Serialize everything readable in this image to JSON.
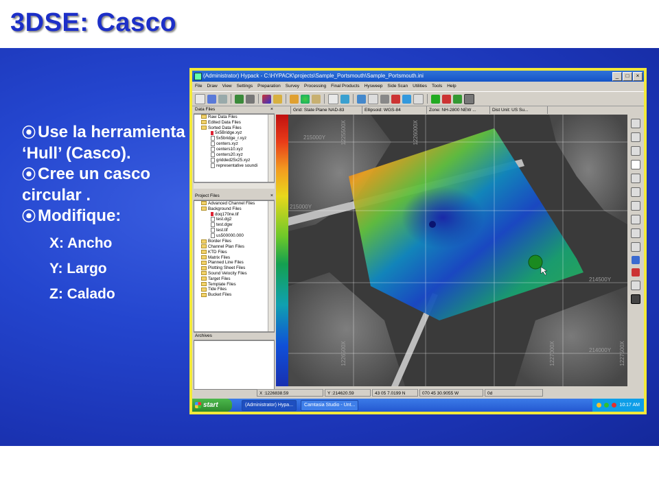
{
  "slide": {
    "title": "3DSE:  Casco",
    "bullets": [
      "Use la herramienta ‘Hull’ (Casco).",
      "Cree un casco circular .",
      "Modifique:"
    ],
    "sub_items": [
      "X:  Ancho",
      "Y:  Largo",
      "Z:  Calado"
    ],
    "bullet_symbol": "⦿"
  },
  "window": {
    "title": "(Administrator) Hypack - C:\\HYPACK\\projects\\Sample_Portsmouth\\Sample_Portsmouth.ini",
    "menu": [
      "File",
      "Draw",
      "View",
      "Settings",
      "Preparation",
      "Survey",
      "Processing",
      "Final Products",
      "Hysweep",
      "Side Scan",
      "Utilities",
      "Tools",
      "Help"
    ]
  },
  "data_files": {
    "header": "Data Files",
    "items": [
      {
        "label": "Raw Data Files",
        "icon": "folder",
        "indent": 1
      },
      {
        "label": "Edited Data Files",
        "icon": "folder",
        "indent": 1
      },
      {
        "label": "Sorted Data Files",
        "icon": "folder",
        "indent": 1
      },
      {
        "label": "5x5Bridge.xyz",
        "icon": "file-red",
        "indent": 2
      },
      {
        "label": "5x5bridge_r.xyz",
        "icon": "file-w",
        "indent": 2
      },
      {
        "label": "centers.xyz",
        "icon": "file-w",
        "indent": 2
      },
      {
        "label": "centers10.xyz",
        "icon": "file-w",
        "indent": 2
      },
      {
        "label": "centers20.xyz",
        "icon": "file-w",
        "indent": 2
      },
      {
        "label": "gridded25x25.xyz",
        "icon": "file-w",
        "indent": 2
      },
      {
        "label": "representative soundi",
        "icon": "file-w",
        "indent": 2
      }
    ]
  },
  "project_files": {
    "header": "Project Files",
    "items": [
      {
        "label": "Advanced Channel Files",
        "icon": "folder",
        "indent": 1
      },
      {
        "label": "Background Files",
        "icon": "folder",
        "indent": 1
      },
      {
        "label": "doq170ne.tif",
        "icon": "file-red",
        "indent": 2
      },
      {
        "label": "test.dg2",
        "icon": "file-w",
        "indent": 2
      },
      {
        "label": "test.dgw",
        "icon": "file-w",
        "indent": 2
      },
      {
        "label": "test.tif",
        "icon": "file-w",
        "indent": 2
      },
      {
        "label": "us500000.000",
        "icon": "file-w",
        "indent": 2
      },
      {
        "label": "Border Files",
        "icon": "folder",
        "indent": 1
      },
      {
        "label": "Channel Plan Files",
        "icon": "folder",
        "indent": 1
      },
      {
        "label": "KTD Files",
        "icon": "folder",
        "indent": 1
      },
      {
        "label": "Matrix Files",
        "icon": "folder",
        "indent": 1
      },
      {
        "label": "Planned Line Files",
        "icon": "folder",
        "indent": 1
      },
      {
        "label": "Plotting Sheet Files",
        "icon": "folder",
        "indent": 1
      },
      {
        "label": "Sound Velocity Files",
        "icon": "folder",
        "indent": 1
      },
      {
        "label": "Target Files",
        "icon": "folder",
        "indent": 1
      },
      {
        "label": "Template Files",
        "icon": "folder",
        "indent": 1
      },
      {
        "label": "Tide Files",
        "icon": "folder",
        "indent": 1
      },
      {
        "label": "Bucket Files",
        "icon": "folder",
        "indent": 1
      }
    ],
    "footer": "Archives"
  },
  "infobar": {
    "grid": "Grid: State Plane NAD-83",
    "ellipsoid": "Ellipsoid: WGS-84",
    "zone": "Zone: NH-2800 NEW ...",
    "dist_unit": "Dist Unit: US Su..."
  },
  "map": {
    "labels_h": [
      "215000Y",
      "214500Y",
      "214000Y",
      "215000Y"
    ],
    "labels_v": [
      "1226500X",
      "1227000X",
      "1227500X",
      "1226000X",
      "1225500X"
    ]
  },
  "status": {
    "x": "X :1226838.59",
    "y": "Y :214620.59",
    "lat": "43 05 7.0199 N",
    "lon": "070 45 30.9055 W",
    "depth": "0d"
  },
  "taskbar": {
    "start": "start",
    "tasks": [
      "(Administrator) Hypa...",
      "Camtasia Studio - Unt..."
    ],
    "clock": "10:17 AM"
  },
  "colors": {
    "title_blue": "#1c2fc8",
    "panel_blue": "#2446cf",
    "frame_yellow": "#f2e93a"
  }
}
